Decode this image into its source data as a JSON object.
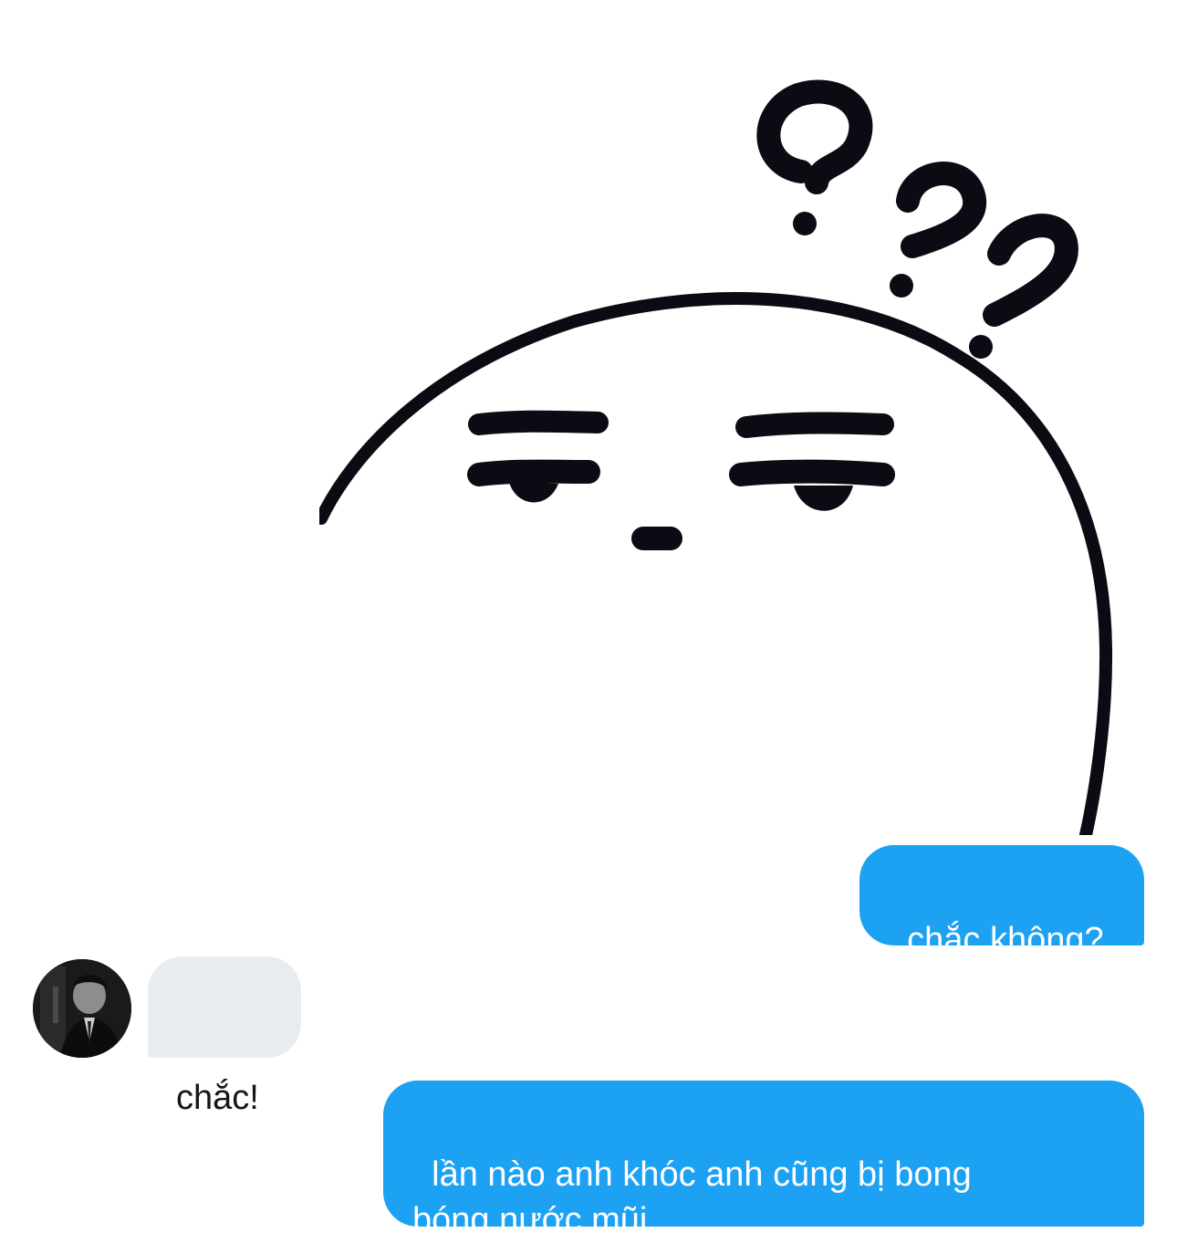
{
  "sticker": {
    "icon": "confused-face-sticker-icon"
  },
  "messages": [
    {
      "direction": "outgoing",
      "text": "chắc không?"
    },
    {
      "direction": "incoming",
      "text": "chắc!",
      "avatar_icon": "user-avatar-photo"
    },
    {
      "direction": "outgoing",
      "text": "lần nào anh khóc anh cũng bị bong\nbóng nước mũi"
    }
  ],
  "colors": {
    "outgoing_bubble": "#1DA1F2",
    "incoming_bubble": "#E6ECF0",
    "outgoing_text": "#FFFFFF",
    "incoming_text": "#14171A"
  }
}
